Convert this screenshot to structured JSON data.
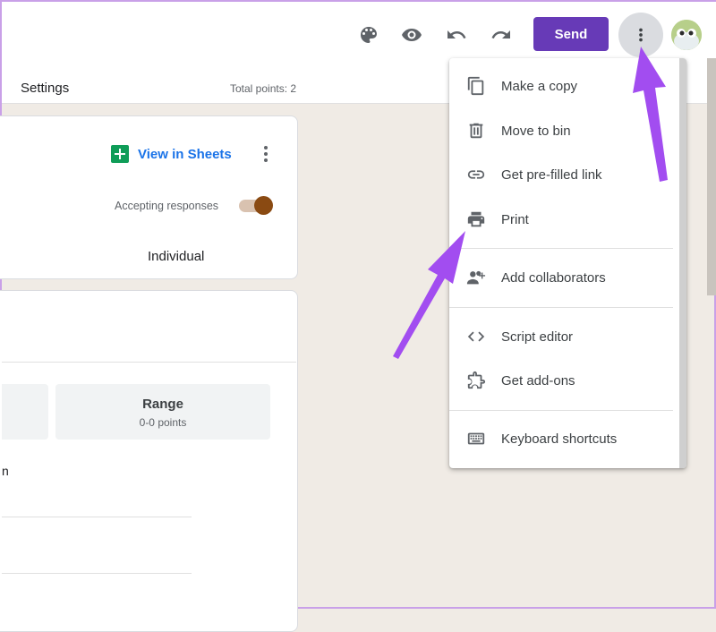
{
  "toolbar": {
    "send_label": "Send",
    "icons": [
      "palette-icon",
      "eye-icon",
      "undo-icon",
      "redo-icon",
      "more-vert-icon"
    ]
  },
  "tabs": {
    "settings_label": "Settings"
  },
  "points": {
    "total_label": "Total points: 2"
  },
  "responses_card": {
    "view_in_sheets_label": "View in Sheets",
    "accepting_label": "Accepting responses",
    "accepting_on": true,
    "individual_label": "Individual"
  },
  "summary_card": {
    "range_title": "Range",
    "range_value": "0-0 points",
    "fragment_text": "n"
  },
  "menu": {
    "items": [
      {
        "label": "Make a copy",
        "icon": "copy-icon"
      },
      {
        "label": "Move to bin",
        "icon": "trash-icon"
      },
      {
        "label": "Get pre-filled link",
        "icon": "link-icon"
      },
      {
        "label": "Print",
        "icon": "print-icon"
      },
      {
        "label": "Add collaborators",
        "icon": "add-people-icon"
      },
      {
        "label": "Script editor",
        "icon": "code-icon"
      },
      {
        "label": "Get add-ons",
        "icon": "puzzle-icon"
      },
      {
        "label": "Keyboard shortcuts",
        "icon": "keyboard-icon"
      }
    ]
  },
  "colors": {
    "accent": "#673ab7",
    "annotation_arrow": "#a24df0",
    "toggle_knob": "#8a4a12",
    "link_blue": "#1a73e8",
    "background": "#f0ebe5"
  }
}
